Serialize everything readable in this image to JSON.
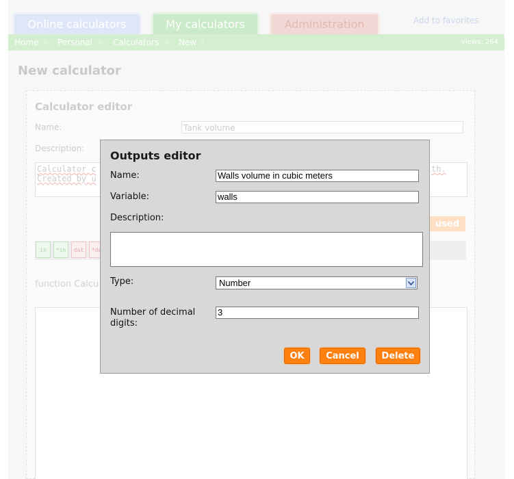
{
  "tabs": {
    "online": "Online calculators",
    "my": "My calculators",
    "admin": "Administration"
  },
  "favorites_link": "Add to favorites",
  "breadcrumb": {
    "items": [
      "Home",
      "Personal",
      "Calculators",
      "New"
    ],
    "views": "Views: 264"
  },
  "page_title": "New calculator",
  "editor": {
    "title": "Calculator editor",
    "name_label": "Name:",
    "name_value": "Tank volume",
    "description_label": "Description:",
    "description_line1_start": "Calculator c",
    "description_line1_end": "th.",
    "description_line2": "Created by u",
    "used_button": "used",
    "toolbar_buttons": [
      "in",
      "*in",
      "dat",
      "*da"
    ],
    "function_label": "function Calcu"
  },
  "dialog": {
    "title": "Outputs editor",
    "name_label": "Name:",
    "name_value": "Walls volume in cubic meters",
    "variable_label": "Variable:",
    "variable_value": "walls",
    "description_label": "Description:",
    "description_value": "",
    "type_label": "Type:",
    "type_value": "Number",
    "decimals_label_line1": "Number of decimal",
    "decimals_label_line2": "digits:",
    "decimals_value": "3",
    "ok_button": "OK",
    "cancel_button": "Cancel",
    "delete_button": "Delete"
  },
  "colors": {
    "accent_orange": "#ff7f0f",
    "nav_green": "#d3efd0",
    "dialog_bg": "#d8d8d8"
  }
}
